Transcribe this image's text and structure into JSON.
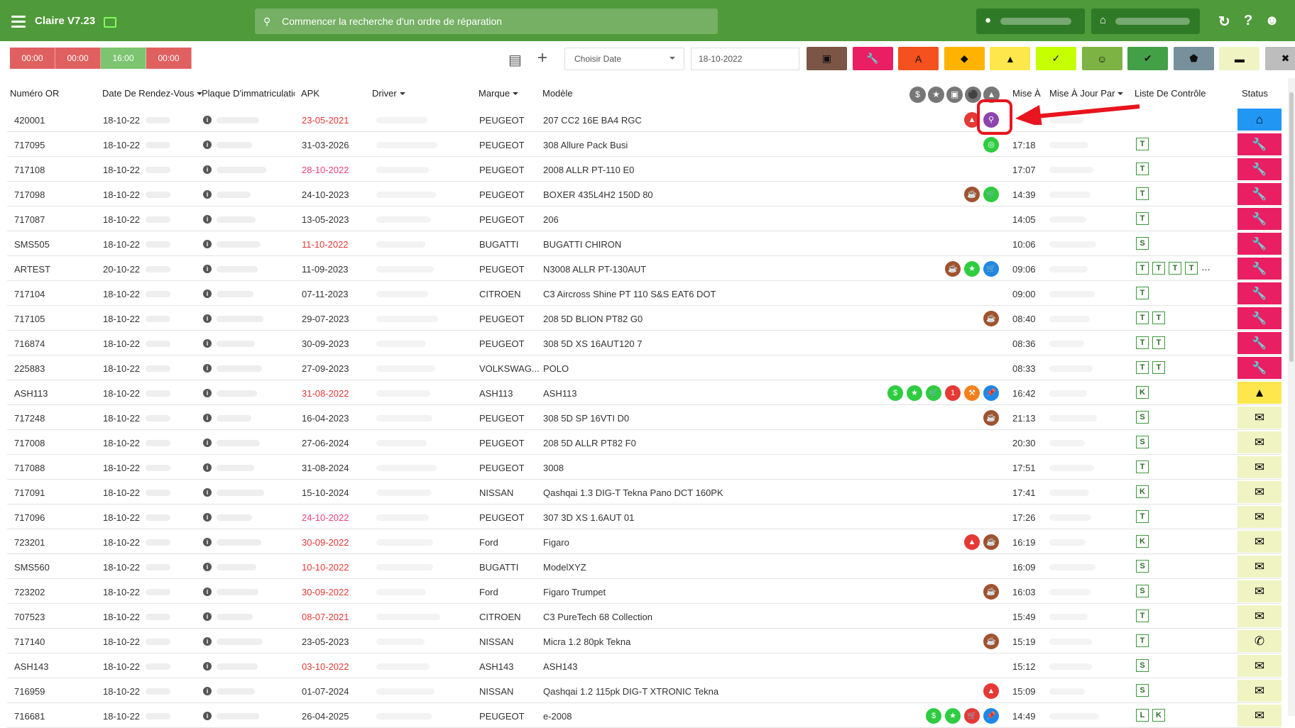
{
  "app": {
    "title": "Claire V7.23"
  },
  "search": {
    "placeholder": "Commencer la recherche d'un ordre de réparation"
  },
  "toolbar": {
    "times": [
      "00:00",
      "00:00",
      "16:00",
      "00:00"
    ],
    "time_colors": [
      "#e06060",
      "#e06060",
      "#7cc470",
      "#e06060"
    ],
    "date_select_label": "Choisir Date",
    "date_value": "18-10-2022",
    "filters": [
      {
        "icon": "calendar-icon",
        "glyph": "▣",
        "color": "#7b5545"
      },
      {
        "icon": "wrench-icon",
        "glyph": "🔧",
        "color": "#e91e63"
      },
      {
        "icon": "letter-a-icon",
        "glyph": "A",
        "color": "#f4511e"
      },
      {
        "icon": "tag-icon",
        "glyph": "◆",
        "color": "#ffb300"
      },
      {
        "icon": "warning-icon",
        "glyph": "▲",
        "color": "#fde74c"
      },
      {
        "icon": "user-check-icon",
        "glyph": "✓",
        "color": "#c6ff00"
      },
      {
        "icon": "face-icon",
        "glyph": "☺",
        "color": "#7cb342"
      },
      {
        "icon": "double-check-icon",
        "glyph": "✔",
        "color": "#43a047"
      },
      {
        "icon": "shield-icon",
        "glyph": "⬟",
        "color": "#78909c"
      },
      {
        "icon": "car-icon",
        "glyph": "▬",
        "color": "#f0f4c3"
      },
      {
        "icon": "close-circle-icon",
        "glyph": "✖",
        "color": "#bdbdbd"
      }
    ]
  },
  "table": {
    "headers": {
      "numero": "Numéro OR",
      "date": "Date De Rendez-Vous",
      "plaque": "Plaque D'immatriculation",
      "apk": "APK",
      "driver": "Driver",
      "marque": "Marque",
      "modele": "Modèle",
      "mise": "Mise À",
      "misepar": "Mise À Jour Par",
      "liste": "Liste De Contrôle",
      "status": "Status"
    },
    "rows": [
      {
        "num": "420001",
        "date": "18-10-22",
        "apk": "23-05-2021",
        "apk_color": "#e53935",
        "marque": "PEUGEOT",
        "modele": "207 CC2 16E BA4 RGC",
        "time": "",
        "checks": [],
        "status": "#2196f3",
        "status_icon": "⌂",
        "icons": [
          {
            "c": "#e53935",
            "g": "▲"
          },
          {
            "c": "#8e44ad",
            "g": "⚲"
          }
        ]
      },
      {
        "num": "717095",
        "date": "18-10-22",
        "apk": "31-03-2026",
        "apk_color": "#333",
        "marque": "PEUGEOT",
        "modele": "308 Allure Pack Busi",
        "time": "17:18",
        "checks": [
          "T"
        ],
        "status": "#e91e63",
        "status_icon": "🔧",
        "icons": [
          {
            "c": "#2ecc40",
            "g": "◎"
          }
        ]
      },
      {
        "num": "717108",
        "date": "18-10-22",
        "apk": "28-10-2022",
        "apk_color": "#ec407a",
        "marque": "PEUGEOT",
        "modele": "2008 ALLR PT-110 E0",
        "time": "17:07",
        "checks": [
          "T"
        ],
        "status": "#e91e63",
        "status_icon": "🔧",
        "icons": []
      },
      {
        "num": "717098",
        "date": "18-10-22",
        "apk": "24-10-2023",
        "apk_color": "#333",
        "marque": "PEUGEOT",
        "modele": "BOXER 435L4H2 150D 80",
        "time": "14:39",
        "checks": [
          "T"
        ],
        "status": "#e91e63",
        "status_icon": "🔧",
        "icons": [
          {
            "c": "#a0522d",
            "g": "☕"
          },
          {
            "c": "#2ecc40",
            "g": "🛒"
          }
        ]
      },
      {
        "num": "717087",
        "date": "18-10-22",
        "apk": "13-05-2023",
        "apk_color": "#333",
        "marque": "PEUGEOT",
        "modele": "206",
        "time": "14:05",
        "checks": [
          "T"
        ],
        "status": "#e91e63",
        "status_icon": "🔧",
        "icons": []
      },
      {
        "num": "SMS505",
        "date": "18-10-22",
        "apk": "11-10-2022",
        "apk_color": "#e53935",
        "marque": "BUGATTI",
        "modele": "BUGATTI CHIRON",
        "time": "10:06",
        "checks": [
          "S"
        ],
        "status": "#e91e63",
        "status_icon": "🔧",
        "icons": []
      },
      {
        "num": "ARTEST",
        "date": "20-10-22",
        "apk": "11-09-2023",
        "apk_color": "#333",
        "marque": "PEUGEOT",
        "modele": "N3008 ALLR PT-130AUT",
        "time": "09:06",
        "checks": [
          "T",
          "T",
          "T",
          "T"
        ],
        "more": "…",
        "status": "#e91e63",
        "status_icon": "🔧",
        "icons": [
          {
            "c": "#a0522d",
            "g": "☕"
          },
          {
            "c": "#2ecc40",
            "g": "★"
          },
          {
            "c": "#1e88e5",
            "g": "🛒"
          }
        ]
      },
      {
        "num": "717104",
        "date": "18-10-22",
        "apk": "07-11-2023",
        "apk_color": "#333",
        "marque": "CITROEN",
        "modele": "C3 Aircross Shine PT 110 S&S EAT6 DOT",
        "time": "09:00",
        "checks": [
          "T"
        ],
        "status": "#e91e63",
        "status_icon": "🔧",
        "icons": []
      },
      {
        "num": "717105",
        "date": "18-10-22",
        "apk": "29-07-2023",
        "apk_color": "#333",
        "marque": "PEUGEOT",
        "modele": "208 5D BLION PT82 G0",
        "time": "08:40",
        "checks": [
          "T",
          "T"
        ],
        "status": "#e91e63",
        "status_icon": "🔧",
        "icons": [
          {
            "c": "#a0522d",
            "g": "☕"
          }
        ]
      },
      {
        "num": "716874",
        "date": "18-10-22",
        "apk": "30-09-2023",
        "apk_color": "#333",
        "marque": "PEUGEOT",
        "modele": "308 5D XS 16AUT120 7",
        "time": "08:36",
        "checks": [
          "T",
          "T"
        ],
        "status": "#e91e63",
        "status_icon": "🔧",
        "icons": []
      },
      {
        "num": "225883",
        "date": "18-10-22",
        "apk": "27-09-2023",
        "apk_color": "#333",
        "marque": "VOLKSWAG...",
        "modele": "POLO",
        "time": "08:33",
        "checks": [
          "T",
          "T"
        ],
        "status": "#e91e63",
        "status_icon": "🔧",
        "icons": []
      },
      {
        "num": "ASH113",
        "date": "18-10-22",
        "apk": "31-08-2022",
        "apk_color": "#e53935",
        "marque": "ASH113",
        "modele": "ASH113",
        "time": "16:42",
        "checks": [
          "K"
        ],
        "status": "#fde74c",
        "status_icon": "▲",
        "icons": [
          {
            "c": "#2ecc40",
            "g": "$"
          },
          {
            "c": "#2ecc40",
            "g": "★"
          },
          {
            "c": "#2ecc40",
            "g": "🛒"
          },
          {
            "c": "#e53935",
            "g": "1"
          },
          {
            "c": "#f4811e",
            "g": "⚒"
          },
          {
            "c": "#1e88e5",
            "g": "📌"
          }
        ]
      },
      {
        "num": "717248",
        "date": "18-10-22",
        "apk": "16-04-2023",
        "apk_color": "#333",
        "marque": "PEUGEOT",
        "modele": "308 5D SP 16VTI D0",
        "time": "21:13",
        "checks": [
          "S"
        ],
        "status": "#f0f4c3",
        "status_icon": "✉",
        "icons": [
          {
            "c": "#a0522d",
            "g": "☕"
          }
        ]
      },
      {
        "num": "717008",
        "date": "18-10-22",
        "apk": "27-06-2024",
        "apk_color": "#333",
        "marque": "PEUGEOT",
        "modele": "208 5D ALLR PT82 F0",
        "time": "20:30",
        "checks": [
          "S"
        ],
        "status": "#f0f4c3",
        "status_icon": "✉",
        "icons": []
      },
      {
        "num": "717088",
        "date": "18-10-22",
        "apk": "31-08-2024",
        "apk_color": "#333",
        "marque": "PEUGEOT",
        "modele": "3008",
        "time": "17:51",
        "checks": [
          "T"
        ],
        "status": "#f0f4c3",
        "status_icon": "✉",
        "icons": []
      },
      {
        "num": "717091",
        "date": "18-10-22",
        "apk": "15-10-2024",
        "apk_color": "#333",
        "marque": "NISSAN",
        "modele": "Qashqai 1.3 DIG-T Tekna Pano DCT 160PK",
        "time": "17:41",
        "checks": [
          "K"
        ],
        "status": "#f0f4c3",
        "status_icon": "✉",
        "icons": []
      },
      {
        "num": "717096",
        "date": "18-10-22",
        "apk": "24-10-2022",
        "apk_color": "#ec407a",
        "marque": "PEUGEOT",
        "modele": "307 3D XS 1.6AUT 01",
        "time": "17:26",
        "checks": [
          "T"
        ],
        "status": "#f0f4c3",
        "status_icon": "✉",
        "icons": []
      },
      {
        "num": "723201",
        "date": "18-10-22",
        "apk": "30-09-2022",
        "apk_color": "#e53935",
        "marque": "Ford",
        "modele": "Figaro",
        "time": "16:19",
        "checks": [
          "K"
        ],
        "status": "#f0f4c3",
        "status_icon": "✉",
        "icons": [
          {
            "c": "#e53935",
            "g": "▲"
          },
          {
            "c": "#a0522d",
            "g": "☕"
          }
        ]
      },
      {
        "num": "SMS560",
        "date": "18-10-22",
        "apk": "10-10-2022",
        "apk_color": "#e53935",
        "marque": "BUGATTI",
        "modele": "ModelXYZ",
        "time": "16:09",
        "checks": [
          "S"
        ],
        "status": "#f0f4c3",
        "status_icon": "✉",
        "icons": []
      },
      {
        "num": "723202",
        "date": "18-10-22",
        "apk": "30-09-2022",
        "apk_color": "#e53935",
        "marque": "Ford",
        "modele": "Figaro Trumpet",
        "time": "16:03",
        "checks": [
          "S"
        ],
        "status": "#f0f4c3",
        "status_icon": "✉",
        "icons": [
          {
            "c": "#a0522d",
            "g": "☕"
          }
        ]
      },
      {
        "num": "707523",
        "date": "18-10-22",
        "apk": "08-07-2021",
        "apk_color": "#e53935",
        "marque": "CITROEN",
        "modele": "C3 PureTech 68 Collection",
        "time": "15:49",
        "checks": [
          "T"
        ],
        "status": "#f0f4c3",
        "status_icon": "✉",
        "icons": []
      },
      {
        "num": "717140",
        "date": "18-10-22",
        "apk": "23-05-2023",
        "apk_color": "#333",
        "marque": "NISSAN",
        "modele": "Micra 1.2 80pk Tekna",
        "time": "15:19",
        "checks": [
          "T"
        ],
        "status": "#f0f4c3",
        "status_icon": "✆",
        "icons": [
          {
            "c": "#a0522d",
            "g": "☕"
          }
        ]
      },
      {
        "num": "ASH143",
        "date": "18-10-22",
        "apk": "03-10-2022",
        "apk_color": "#e53935",
        "marque": "ASH143",
        "modele": "ASH143",
        "time": "15:12",
        "checks": [
          "S"
        ],
        "status": "#f0f4c3",
        "status_icon": "✉",
        "icons": []
      },
      {
        "num": "716959",
        "date": "18-10-22",
        "apk": "01-07-2024",
        "apk_color": "#333",
        "marque": "NISSAN",
        "modele": "Qashqai 1.2 115pk DIG-T XTRONIC Tekna",
        "time": "15:09",
        "checks": [
          "S"
        ],
        "status": "#f0f4c3",
        "status_icon": "✉",
        "icons": [
          {
            "c": "#e53935",
            "g": "▲"
          }
        ]
      },
      {
        "num": "716681",
        "date": "18-10-22",
        "apk": "26-04-2025",
        "apk_color": "#333",
        "marque": "PEUGEOT",
        "modele": "e-2008",
        "time": "14:49",
        "checks": [
          "L",
          "K"
        ],
        "status": "#f0f4c3",
        "status_icon": "✉",
        "icons": [
          {
            "c": "#2ecc40",
            "g": "$"
          },
          {
            "c": "#2ecc40",
            "g": "★"
          },
          {
            "c": "#e53935",
            "g": "🛒"
          },
          {
            "c": "#1e88e5",
            "g": "📌"
          }
        ]
      }
    ]
  }
}
